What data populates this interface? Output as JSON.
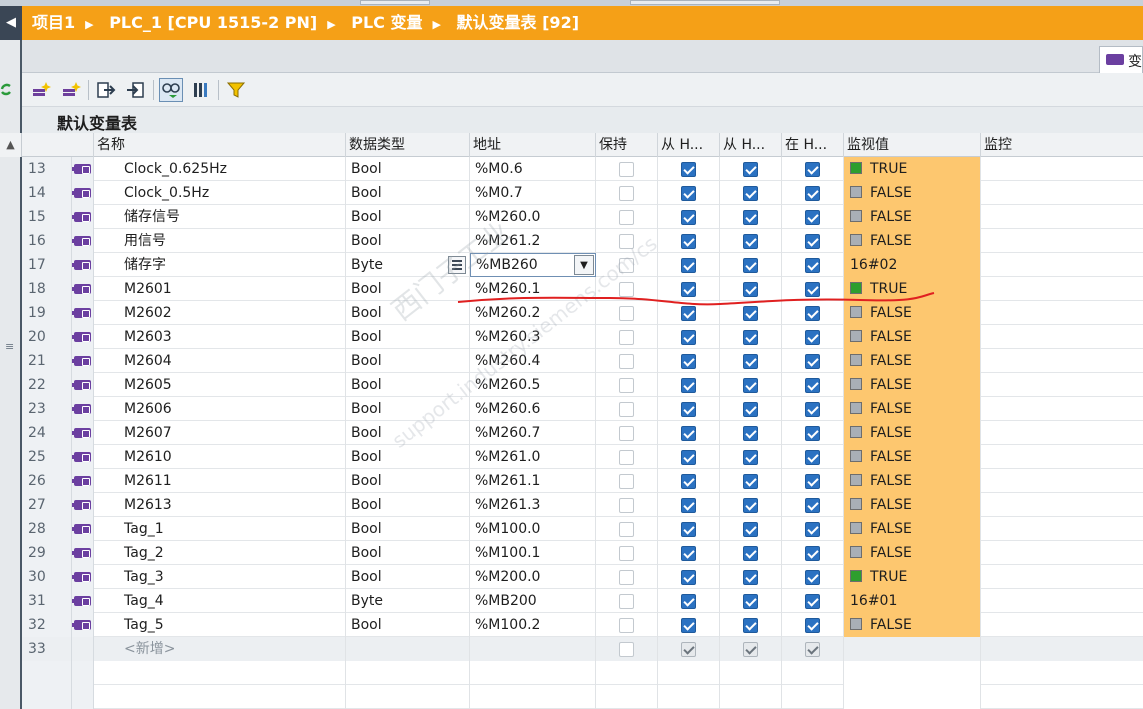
{
  "breadcrumb": {
    "items": [
      "项目1",
      "PLC_1 [CPU 1515-2 PN]",
      "PLC 变量",
      "默认变量表 [92]"
    ]
  },
  "tab": {
    "label": "变"
  },
  "table_title": "默认变量表",
  "columns": {
    "name": "名称",
    "datatype": "数据类型",
    "address": "地址",
    "retain": "保持",
    "accessible_hmi": "从 H...",
    "writable_hmi": "从 H...",
    "visible_hmi": "在 H...",
    "monitor_value": "监视值",
    "control": "监控"
  },
  "rows": [
    {
      "num": "13",
      "name": "Clock_0.625Hz",
      "type": "Bool",
      "address": "%M0.6",
      "monitor": "TRUE"
    },
    {
      "num": "14",
      "name": "Clock_0.5Hz",
      "type": "Bool",
      "address": "%M0.7",
      "monitor": "FALSE"
    },
    {
      "num": "15",
      "name": "储存信号",
      "type": "Bool",
      "address": "%M260.0",
      "monitor": "FALSE"
    },
    {
      "num": "16",
      "name": "用信号",
      "type": "Bool",
      "address": "%M261.2",
      "monitor": "FALSE"
    },
    {
      "num": "17",
      "name": "储存字",
      "type": "Byte",
      "address": "%MB260",
      "monitor": "16#02"
    },
    {
      "num": "18",
      "name": "M2601",
      "type": "Bool",
      "address": "%M260.1",
      "monitor": "TRUE"
    },
    {
      "num": "19",
      "name": "M2602",
      "type": "Bool",
      "address": "%M260.2",
      "monitor": "FALSE"
    },
    {
      "num": "20",
      "name": "M2603",
      "type": "Bool",
      "address": "%M260.3",
      "monitor": "FALSE"
    },
    {
      "num": "21",
      "name": "M2604",
      "type": "Bool",
      "address": "%M260.4",
      "monitor": "FALSE"
    },
    {
      "num": "22",
      "name": "M2605",
      "type": "Bool",
      "address": "%M260.5",
      "monitor": "FALSE"
    },
    {
      "num": "23",
      "name": "M2606",
      "type": "Bool",
      "address": "%M260.6",
      "monitor": "FALSE"
    },
    {
      "num": "24",
      "name": "M2607",
      "type": "Bool",
      "address": "%M260.7",
      "monitor": "FALSE"
    },
    {
      "num": "25",
      "name": "M2610",
      "type": "Bool",
      "address": "%M261.0",
      "monitor": "FALSE"
    },
    {
      "num": "26",
      "name": "M2611",
      "type": "Bool",
      "address": "%M261.1",
      "monitor": "FALSE"
    },
    {
      "num": "27",
      "name": "M2613",
      "type": "Bool",
      "address": "%M261.3",
      "monitor": "FALSE"
    },
    {
      "num": "28",
      "name": "Tag_1",
      "type": "Bool",
      "address": "%M100.0",
      "monitor": "FALSE"
    },
    {
      "num": "29",
      "name": "Tag_2",
      "type": "Bool",
      "address": "%M100.1",
      "monitor": "FALSE"
    },
    {
      "num": "30",
      "name": "Tag_3",
      "type": "Bool",
      "address": "%M200.0",
      "monitor": "TRUE"
    },
    {
      "num": "31",
      "name": "Tag_4",
      "type": "Byte",
      "address": "%MB200",
      "monitor": "16#01"
    },
    {
      "num": "32",
      "name": "Tag_5",
      "type": "Bool",
      "address": "%M100.2",
      "monitor": "FALSE"
    }
  ],
  "new_row": {
    "num": "33",
    "name": "<新增>"
  },
  "watermark": {
    "line1": "西门子工业",
    "line2": "support.industry.siemens.com/cs"
  },
  "colors": {
    "accent": "#f5a017",
    "monitor_bg": "#fdc76f",
    "checkbox": "#2b72c2",
    "annotation": "#e02020"
  }
}
